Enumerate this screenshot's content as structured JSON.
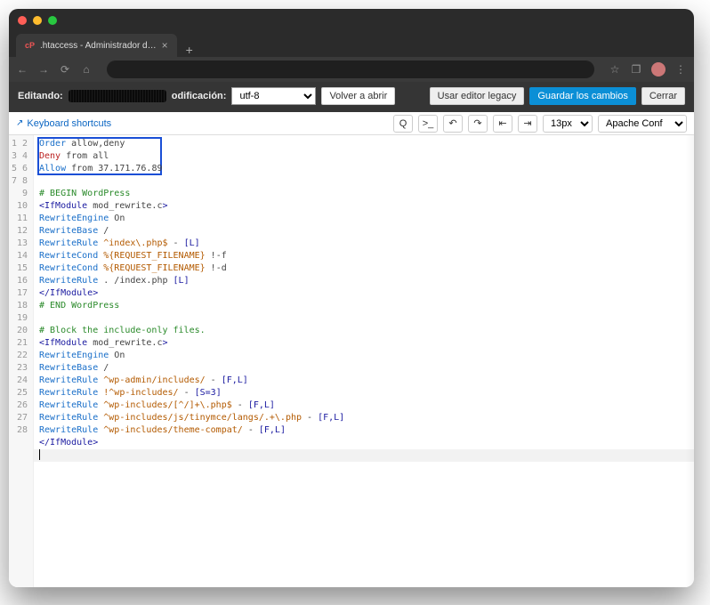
{
  "browser": {
    "tab_title": ".htaccess - Administrador d…",
    "favicon_char": "cP",
    "new_tab_char": "+"
  },
  "cpanel": {
    "editing_label": "Editando:",
    "encoding_label": "odificación:",
    "encoding_value": "utf-8",
    "reopen_label": "Volver a abrir",
    "legacy_label": "Usar editor legacy",
    "save_label": "Guardar los cambios",
    "close_label": "Cerrar"
  },
  "toolbar": {
    "kb_shortcuts": "Keyboard shortcuts",
    "fontsize": "13px",
    "syntax": "Apache Conf"
  },
  "code_lines": [
    [
      [
        "c-dir",
        "Order"
      ],
      [
        "c-txt",
        " allow,deny"
      ]
    ],
    [
      [
        "c-kw",
        "Deny"
      ],
      [
        "c-txt",
        " from all"
      ]
    ],
    [
      [
        "c-dir",
        "Allow"
      ],
      [
        "c-txt",
        " from 37.171.76.89"
      ]
    ],
    [],
    [
      [
        "c-cmt",
        "# BEGIN WordPress"
      ]
    ],
    [
      [
        "c-tag",
        "<IfModule"
      ],
      [
        "c-txt",
        " mod_rewrite.c"
      ],
      [
        "c-tag",
        ">"
      ]
    ],
    [
      [
        "c-dir",
        "RewriteEngine"
      ],
      [
        "c-txt",
        " On"
      ]
    ],
    [
      [
        "c-dir",
        "RewriteBase"
      ],
      [
        "c-txt",
        " /"
      ]
    ],
    [
      [
        "c-dir",
        "RewriteRule"
      ],
      [
        "c-arg",
        " ^index\\.php$"
      ],
      [
        "c-txt",
        " - "
      ],
      [
        "c-flag",
        "[L]"
      ]
    ],
    [
      [
        "c-dir",
        "RewriteCond"
      ],
      [
        "c-arg",
        " %{REQUEST_FILENAME}"
      ],
      [
        "c-txt",
        " !-f"
      ]
    ],
    [
      [
        "c-dir",
        "RewriteCond"
      ],
      [
        "c-arg",
        " %{REQUEST_FILENAME}"
      ],
      [
        "c-txt",
        " !-d"
      ]
    ],
    [
      [
        "c-dir",
        "RewriteRule"
      ],
      [
        "c-txt",
        " . /index.php "
      ],
      [
        "c-flag",
        "[L]"
      ]
    ],
    [
      [
        "c-tag",
        "</IfModule>"
      ]
    ],
    [
      [
        "c-cmt",
        "# END WordPress"
      ]
    ],
    [],
    [
      [
        "c-cmt",
        "# Block the include-only files."
      ]
    ],
    [
      [
        "c-tag",
        "<IfModule"
      ],
      [
        "c-txt",
        " mod_rewrite.c"
      ],
      [
        "c-tag",
        ">"
      ]
    ],
    [
      [
        "c-dir",
        "RewriteEngine"
      ],
      [
        "c-txt",
        " On"
      ]
    ],
    [
      [
        "c-dir",
        "RewriteBase"
      ],
      [
        "c-txt",
        " /"
      ]
    ],
    [
      [
        "c-dir",
        "RewriteRule"
      ],
      [
        "c-arg",
        " ^wp-admin/includes/"
      ],
      [
        "c-txt",
        " - "
      ],
      [
        "c-flag",
        "[F,L]"
      ]
    ],
    [
      [
        "c-dir",
        "RewriteRule"
      ],
      [
        "c-arg",
        " !^wp-includes/"
      ],
      [
        "c-txt",
        " - "
      ],
      [
        "c-flag",
        "[S=3]"
      ]
    ],
    [
      [
        "c-dir",
        "RewriteRule"
      ],
      [
        "c-arg",
        " ^wp-includes/[^/]+\\.php$"
      ],
      [
        "c-txt",
        " - "
      ],
      [
        "c-flag",
        "[F,L]"
      ]
    ],
    [
      [
        "c-dir",
        "RewriteRule"
      ],
      [
        "c-arg",
        " ^wp-includes/js/tinymce/langs/.+\\.php"
      ],
      [
        "c-txt",
        " - "
      ],
      [
        "c-flag",
        "[F,L]"
      ]
    ],
    [
      [
        "c-dir",
        "RewriteRule"
      ],
      [
        "c-arg",
        " ^wp-includes/theme-compat/"
      ],
      [
        "c-txt",
        " - "
      ],
      [
        "c-flag",
        "[F,L]"
      ]
    ],
    [
      [
        "c-tag",
        "</IfModule>"
      ]
    ],
    [
      [
        "caret",
        ""
      ]
    ],
    [],
    []
  ],
  "line_count": 28
}
